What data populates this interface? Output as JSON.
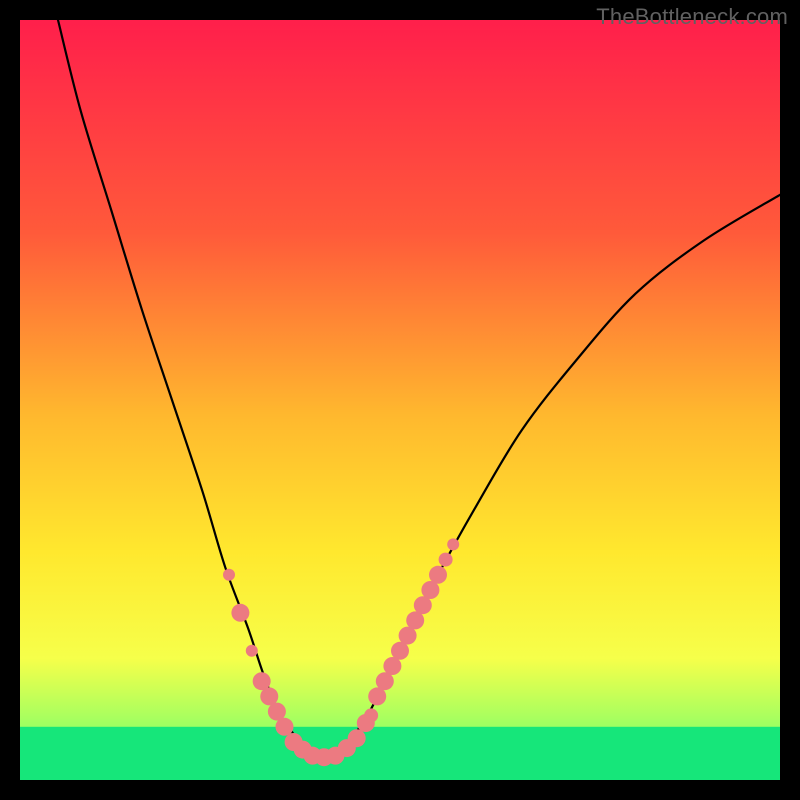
{
  "watermark": "TheBottleneck.com",
  "chart_data": {
    "type": "line",
    "title": "",
    "xlabel": "",
    "ylabel": "",
    "xlim": [
      0,
      100
    ],
    "ylim": [
      0,
      100
    ],
    "gradient_stops": [
      {
        "offset": 0,
        "color": "#ff1f4b"
      },
      {
        "offset": 28,
        "color": "#ff5a3a"
      },
      {
        "offset": 52,
        "color": "#ffb82e"
      },
      {
        "offset": 70,
        "color": "#ffe82e"
      },
      {
        "offset": 84,
        "color": "#f6ff4a"
      },
      {
        "offset": 93,
        "color": "#9dff62"
      },
      {
        "offset": 100,
        "color": "#16e67a"
      }
    ],
    "bottom_band": {
      "from": 93,
      "to": 100,
      "color": "#16e67a"
    },
    "series": [
      {
        "name": "bottleneck-curve",
        "x": [
          5,
          8,
          12,
          16,
          20,
          24,
          27,
          30,
          32,
          34,
          36,
          37,
          38,
          39,
          40,
          42,
          44,
          46,
          48,
          51,
          55,
          60,
          66,
          73,
          81,
          90,
          100
        ],
        "y": [
          100,
          88,
          75,
          62,
          50,
          38,
          28,
          20,
          14,
          9,
          6,
          4,
          3,
          3,
          3,
          4,
          6,
          9,
          13,
          19,
          27,
          36,
          46,
          55,
          64,
          71,
          77
        ]
      }
    ],
    "markers": {
      "color": "#ec7a81",
      "points": [
        {
          "x": 27.5,
          "y": 27,
          "r": 6
        },
        {
          "x": 29.0,
          "y": 22,
          "r": 9
        },
        {
          "x": 30.5,
          "y": 17,
          "r": 6
        },
        {
          "x": 31.8,
          "y": 13,
          "r": 9
        },
        {
          "x": 32.8,
          "y": 11,
          "r": 9
        },
        {
          "x": 33.8,
          "y": 9,
          "r": 9
        },
        {
          "x": 34.8,
          "y": 7,
          "r": 9
        },
        {
          "x": 36.0,
          "y": 5,
          "r": 9
        },
        {
          "x": 37.2,
          "y": 4,
          "r": 9
        },
        {
          "x": 38.5,
          "y": 3.2,
          "r": 9
        },
        {
          "x": 40.0,
          "y": 3.0,
          "r": 9
        },
        {
          "x": 41.5,
          "y": 3.2,
          "r": 9
        },
        {
          "x": 43.0,
          "y": 4.2,
          "r": 9
        },
        {
          "x": 44.3,
          "y": 5.5,
          "r": 9
        },
        {
          "x": 45.5,
          "y": 7.5,
          "r": 9
        },
        {
          "x": 46.2,
          "y": 8.5,
          "r": 7
        },
        {
          "x": 47.0,
          "y": 11,
          "r": 9
        },
        {
          "x": 48.0,
          "y": 13,
          "r": 9
        },
        {
          "x": 49.0,
          "y": 15,
          "r": 9
        },
        {
          "x": 50.0,
          "y": 17,
          "r": 9
        },
        {
          "x": 51.0,
          "y": 19,
          "r": 9
        },
        {
          "x": 52.0,
          "y": 21,
          "r": 9
        },
        {
          "x": 53.0,
          "y": 23,
          "r": 9
        },
        {
          "x": 54.0,
          "y": 25,
          "r": 9
        },
        {
          "x": 55.0,
          "y": 27,
          "r": 9
        },
        {
          "x": 56.0,
          "y": 29,
          "r": 7
        },
        {
          "x": 57.0,
          "y": 31,
          "r": 6
        }
      ]
    }
  }
}
